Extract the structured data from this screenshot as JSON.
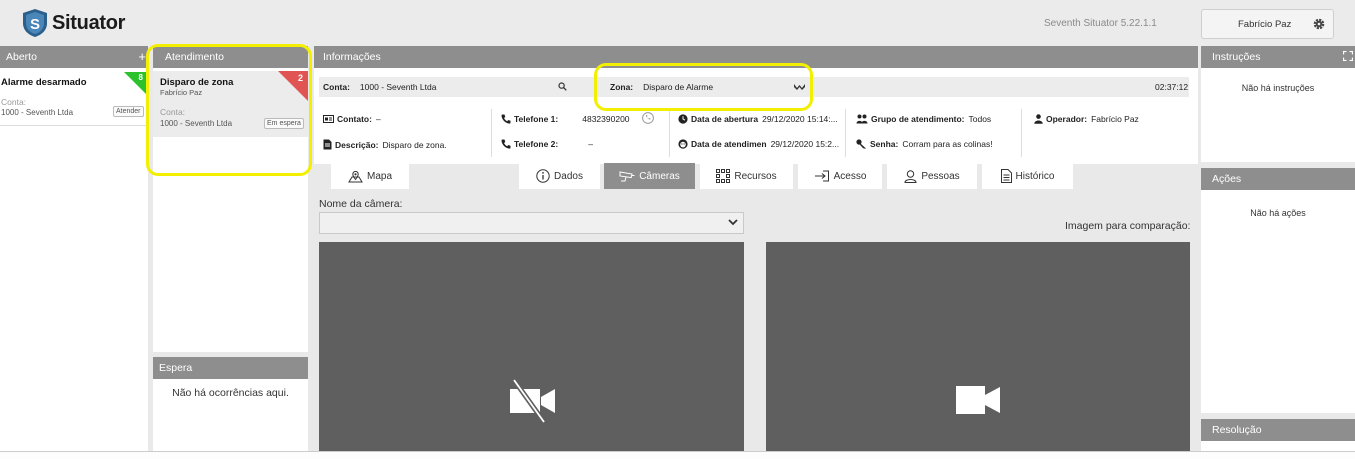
{
  "app": {
    "logo_text": "Situator",
    "version": "Seventh Situator 5.22.1.1",
    "user_name": "Fabrício Paz"
  },
  "aberto": {
    "title": "Aberto",
    "plus": "+",
    "card": {
      "title": "Alarme desarmado",
      "count": "8",
      "conta_label": "Conta:",
      "conta_value": "1000 - Seventh Ltda",
      "button": "Atender"
    }
  },
  "atendimento": {
    "title": "Atendimento",
    "card": {
      "title": "Disparo de zona",
      "user": "Fabrício Paz",
      "count": "2",
      "conta_label": "Conta:",
      "conta_value": "1000 - Seventh Ltda",
      "status": "Em espera"
    }
  },
  "espera": {
    "title": "Espera",
    "empty": "Não há ocorrências aqui."
  },
  "informacoes": {
    "title": "Informações",
    "conta_label": "Conta:",
    "conta_value": "1000 - Seventh Ltda",
    "zona_label": "Zona:",
    "zona_value": "Disparo de Alarme",
    "timer": "02:37:12",
    "contato_label": "Contato:",
    "contato_value": "–",
    "descricao_label": "Descrição:",
    "descricao_value": "Disparo de zona.",
    "telefone1_label": "Telefone 1:",
    "telefone1_value": "4832390200",
    "telefone2_label": "Telefone 2:",
    "telefone2_value": "–",
    "abertura_label": "Data de abertura",
    "abertura_value": "29/12/2020 15:14:...",
    "atendimento_label": "Data de atendimen",
    "atendimento_value": "29/12/2020 15:2...",
    "grupo_label": "Grupo de atendimento:",
    "grupo_value": "Todos",
    "senha_label": "Senha:",
    "senha_value": "Corram para as colinas!",
    "operador_label": "Operador:",
    "operador_value": "Fabrício Paz"
  },
  "tabs": [
    {
      "label": "Mapa"
    },
    {
      "label": "Dados"
    },
    {
      "label": "Câmeras"
    },
    {
      "label": "Recursos"
    },
    {
      "label": "Acesso"
    },
    {
      "label": "Pessoas"
    },
    {
      "label": "Histórico"
    }
  ],
  "cameras": {
    "name_label": "Nome da câmera:",
    "compare_label": "Imagem para comparação:",
    "selected": ""
  },
  "instrucoes": {
    "title": "Instruções",
    "empty": "Não há instruções"
  },
  "acoes": {
    "title": "Ações",
    "empty": "Não há ações"
  },
  "resolucao": {
    "title": "Resolução"
  },
  "colors": {
    "panel_header": "#8e8e8e",
    "aberto_badge": "#2dc12d",
    "atend_badge": "#e05454",
    "highlight": "#f2ef00",
    "video_bg": "#5f5f5f"
  }
}
